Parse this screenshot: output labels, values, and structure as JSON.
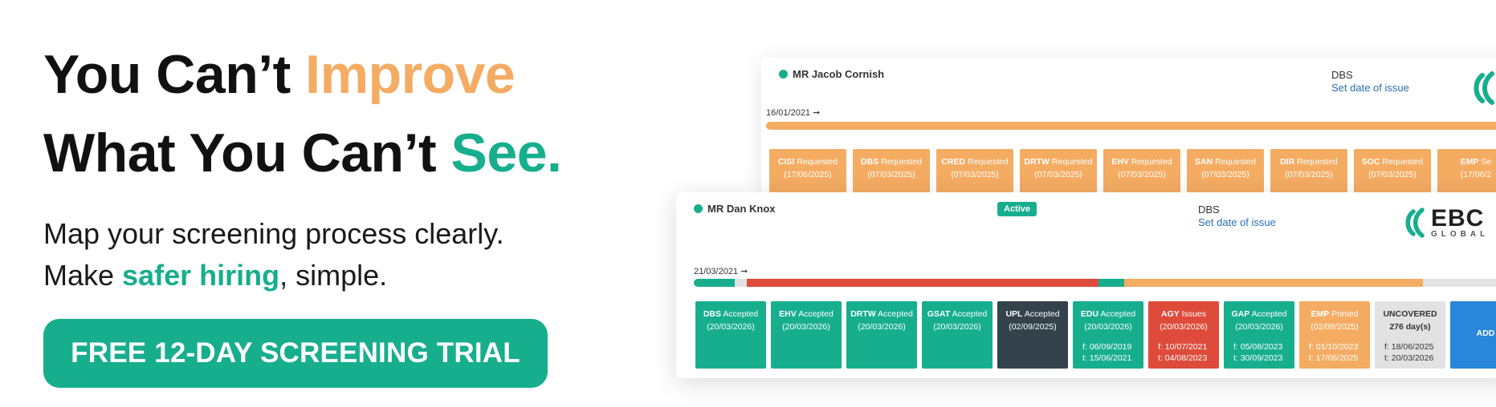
{
  "hero": {
    "line1_a": "You Can’t ",
    "line1_b": "Improve",
    "line2_a": "What You Can’t ",
    "line2_b": "See.",
    "sub1": "Map your screening process clearly.",
    "sub2_a": "Make ",
    "sub2_b": "safer hiring",
    "sub2_c": ", simple.",
    "cta": "FREE 12-DAY SCREENING TRIAL"
  },
  "back_card": {
    "name": "MR Jacob Cornish",
    "dbs_label": "DBS",
    "dbs_link": "Set date of issue",
    "date": "16/01/2021 ➞",
    "chips": [
      {
        "code": "CISI",
        "status": "Requested",
        "date": "(17/06/2025)"
      },
      {
        "code": "DBS",
        "status": "Requested",
        "date": "(07/03/2025)"
      },
      {
        "code": "CRED",
        "status": "Requested",
        "date": "(07/03/2025)"
      },
      {
        "code": "DRTW",
        "status": "Requested",
        "date": "(07/03/2025)"
      },
      {
        "code": "EHV",
        "status": "Requested",
        "date": "(07/03/2025)"
      },
      {
        "code": "SAN",
        "status": "Requested",
        "date": "(07/03/2025)"
      },
      {
        "code": "DIR",
        "status": "Requested",
        "date": "(07/03/2025)"
      },
      {
        "code": "SOC",
        "status": "Requested",
        "date": "(07/03/2025)"
      },
      {
        "code": "EMP",
        "status": "Se",
        "date": "(17/06/2"
      }
    ]
  },
  "front_card": {
    "name": "MR Dan Knox",
    "status_badge": "Active",
    "dbs_label": "DBS",
    "dbs_link": "Set date of issue",
    "date": "21/03/2021 ➞",
    "logo_text": "EBC",
    "logo_sub": "GLOBAL",
    "chips": [
      {
        "code": "DBS",
        "status": "Accepted",
        "date": "(20/03/2026)",
        "from": "",
        "to": ""
      },
      {
        "code": "EHV",
        "status": "Accepted",
        "date": "(20/03/2026)",
        "from": "",
        "to": ""
      },
      {
        "code": "DRTW",
        "status": "Accepted",
        "date": "(20/03/2026)",
        "from": "",
        "to": ""
      },
      {
        "code": "GSAT",
        "status": "Accepted",
        "date": "(20/03/2026)",
        "from": "",
        "to": ""
      },
      {
        "code": "UPL",
        "status": "Accepted",
        "date": "(02/09/2025)",
        "from": "",
        "to": ""
      },
      {
        "code": "EDU",
        "status": "Accepted",
        "date": "(20/03/2026)",
        "from": "f: 06/09/2019",
        "to": "t: 15/06/2021"
      },
      {
        "code": "AGY",
        "status": "Issues",
        "date": "(20/03/2026)",
        "from": "f: 10/07/2021",
        "to": "t: 04/08/2023"
      },
      {
        "code": "GAP",
        "status": "Accepted",
        "date": "(20/03/2026)",
        "from": "f: 05/08/2023",
        "to": "t: 30/09/2023"
      },
      {
        "code": "EMP",
        "status": "Printed",
        "date": "(02/09/2025)",
        "from": "f: 01/10/2023",
        "to": "t: 17/06/2025"
      },
      {
        "code": "UNCOVERED",
        "status": "",
        "date": "276 day(s)",
        "from": "f: 18/06/2025",
        "to": "t: 20/03/2026"
      },
      {
        "code": "ADD",
        "status": "",
        "date": "",
        "from": "",
        "to": ""
      }
    ]
  },
  "colors": {
    "teal": "#17ae8e",
    "orange": "#f4ac63",
    "red": "#de4b3a",
    "dark": "#34434b",
    "grey": "#e2e2e2",
    "blue": "#2a86d8",
    "link": "#2a6db8"
  },
  "icons": [
    "ebc-logo-icon",
    "arrow-right-icon"
  ]
}
